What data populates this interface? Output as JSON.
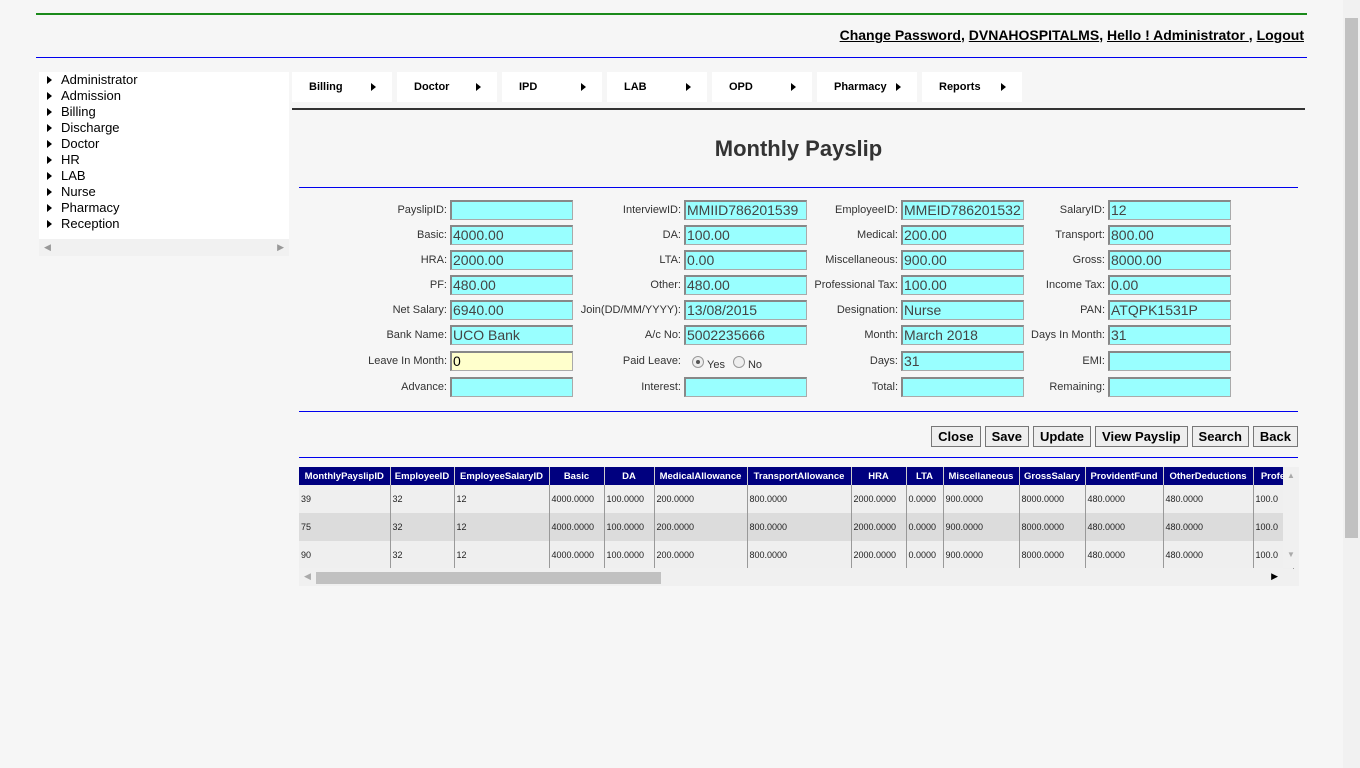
{
  "header": {
    "change_password": "Change Password",
    "hospital": "DVNAHOSPITALMS",
    "greeting": "Hello ! Administrator ",
    "logout": "Logout"
  },
  "sidebar": {
    "items": [
      "Administrator",
      "Admission",
      "Billing",
      "Discharge",
      "Doctor",
      "HR",
      "LAB",
      "Nurse",
      "Pharmacy",
      "Reception"
    ]
  },
  "menu": [
    "Billing",
    "Doctor",
    "IPD",
    "LAB",
    "OPD",
    "Pharmacy",
    "Reports"
  ],
  "page_title": "Monthly Payslip",
  "form": {
    "r0": [
      [
        "PayslipID:",
        ""
      ],
      [
        "InterviewID:",
        "MMIID786201539"
      ],
      [
        "EmployeeID:",
        "MMEID786201532"
      ],
      [
        "SalaryID:",
        "12"
      ]
    ],
    "r1": [
      [
        "Basic:",
        "4000.00"
      ],
      [
        "DA:",
        "100.00"
      ],
      [
        "Medical:",
        "200.00"
      ],
      [
        "Transport:",
        "800.00"
      ]
    ],
    "r2": [
      [
        "HRA:",
        "2000.00"
      ],
      [
        "LTA:",
        "0.00"
      ],
      [
        "Miscellaneous:",
        "900.00"
      ],
      [
        "Gross:",
        "8000.00"
      ]
    ],
    "r3": [
      [
        "PF:",
        "480.00"
      ],
      [
        "Other:",
        "480.00"
      ],
      [
        "Professional Tax:",
        "100.00"
      ],
      [
        "Income Tax:",
        "0.00"
      ]
    ],
    "r4": [
      [
        "Net Salary:",
        "6940.00"
      ],
      [
        "Join(DD/MM/YYYY):",
        "13/08/2015"
      ],
      [
        "Designation:",
        "Nurse"
      ],
      [
        "PAN:",
        "ATQPK1531P"
      ]
    ],
    "r5": [
      [
        "Bank Name:",
        "UCO Bank"
      ],
      [
        "A/c No:",
        "5002235666"
      ],
      [
        "Month:",
        "March 2018"
      ],
      [
        "Days In Month:",
        "31"
      ]
    ],
    "r6": [
      [
        "Leave In Month:",
        "0"
      ],
      [
        "Paid Leave:",
        ""
      ],
      [
        "Days:",
        "31"
      ],
      [
        "EMI:",
        ""
      ]
    ],
    "r7": [
      [
        "Advance:",
        ""
      ],
      [
        "Interest:",
        ""
      ],
      [
        "Total:",
        ""
      ],
      [
        "Remaining:",
        ""
      ]
    ],
    "paid_leave": {
      "yes": "Yes",
      "no": "No",
      "selected": "Yes"
    }
  },
  "buttons": [
    "Close",
    "Save",
    "Update",
    "View Payslip",
    "Search",
    "Back"
  ],
  "table": {
    "columns": [
      "MonthlyPayslipID",
      "EmployeeID",
      "EmployeeSalaryID",
      "Basic",
      "DA",
      "MedicalAllowance",
      "TransportAllowance",
      "HRA",
      "LTA",
      "Miscellaneous",
      "GrossSalary",
      "ProvidentFund",
      "OtherDeductions",
      "Profe"
    ],
    "rows": [
      [
        "39",
        "32",
        "12",
        "4000.0000",
        "100.0000",
        "200.0000",
        "800.0000",
        "2000.0000",
        "0.0000",
        "900.0000",
        "8000.0000",
        "480.0000",
        "480.0000",
        "100.0"
      ],
      [
        "75",
        "32",
        "12",
        "4000.0000",
        "100.0000",
        "200.0000",
        "800.0000",
        "2000.0000",
        "0.0000",
        "900.0000",
        "8000.0000",
        "480.0000",
        "480.0000",
        "100.0"
      ],
      [
        "90",
        "32",
        "12",
        "4000.0000",
        "100.0000",
        "200.0000",
        "800.0000",
        "2000.0000",
        "0.0000",
        "900.0000",
        "8000.0000",
        "480.0000",
        "480.0000",
        "100.0"
      ]
    ]
  }
}
